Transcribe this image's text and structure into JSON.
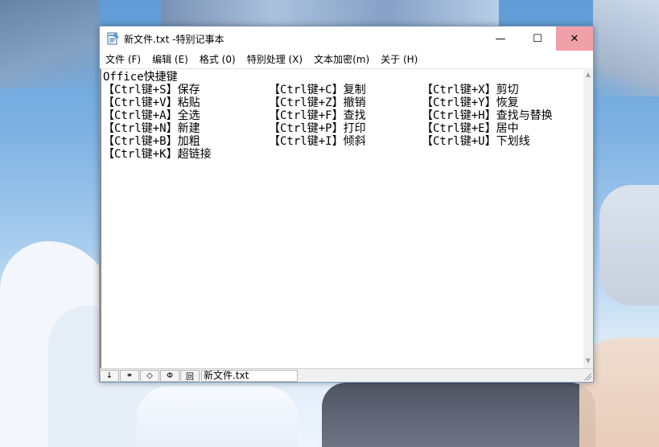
{
  "window": {
    "title": "新文件.txt -特别记事本",
    "minimize_symbol": "—",
    "maximize_symbol": "☐",
    "close_symbol": "✕"
  },
  "menu": [
    {
      "label": "文件 (F)"
    },
    {
      "label": "编辑 (E)"
    },
    {
      "label": "格式 (0)"
    },
    {
      "label": "特别处理 (X)"
    },
    {
      "label": "文本加密(m)"
    },
    {
      "label": "关于 (H)"
    }
  ],
  "editor": {
    "heading": "Office快捷键",
    "rows": [
      [
        "【Ctrl键+S】保存",
        "【Ctrl键+C】复制",
        "【Ctrl键+X】剪切"
      ],
      [
        "【Ctrl键+V】粘贴",
        "【Ctrl键+Z】撤销",
        "【Ctrl键+Y】恢复"
      ],
      [
        "【Ctrl键+A】全选",
        "【Ctrl键+F】查找",
        "【Ctrl键+H】查找与替换"
      ],
      [
        "【Ctrl键+N】新建",
        "【Ctrl键+P】打印",
        "【Ctrl键+E】居中"
      ],
      [
        "【Ctrl键+B】加粗",
        "【Ctrl键+I】倾斜",
        "【Ctrl键+U】下划线"
      ],
      [
        "【Ctrl键+K】超链接",
        "",
        ""
      ]
    ]
  },
  "statusbar": {
    "buttons": [
      "↓",
      "⚭",
      "◇",
      "Φ",
      "回"
    ],
    "filename": "新文件.txt"
  },
  "scrollbar": {
    "up_symbol": "▲",
    "down_symbol": "▼"
  },
  "colors": {
    "close_hover": "#f0a0a8",
    "window_border": "#7b9cc4"
  }
}
